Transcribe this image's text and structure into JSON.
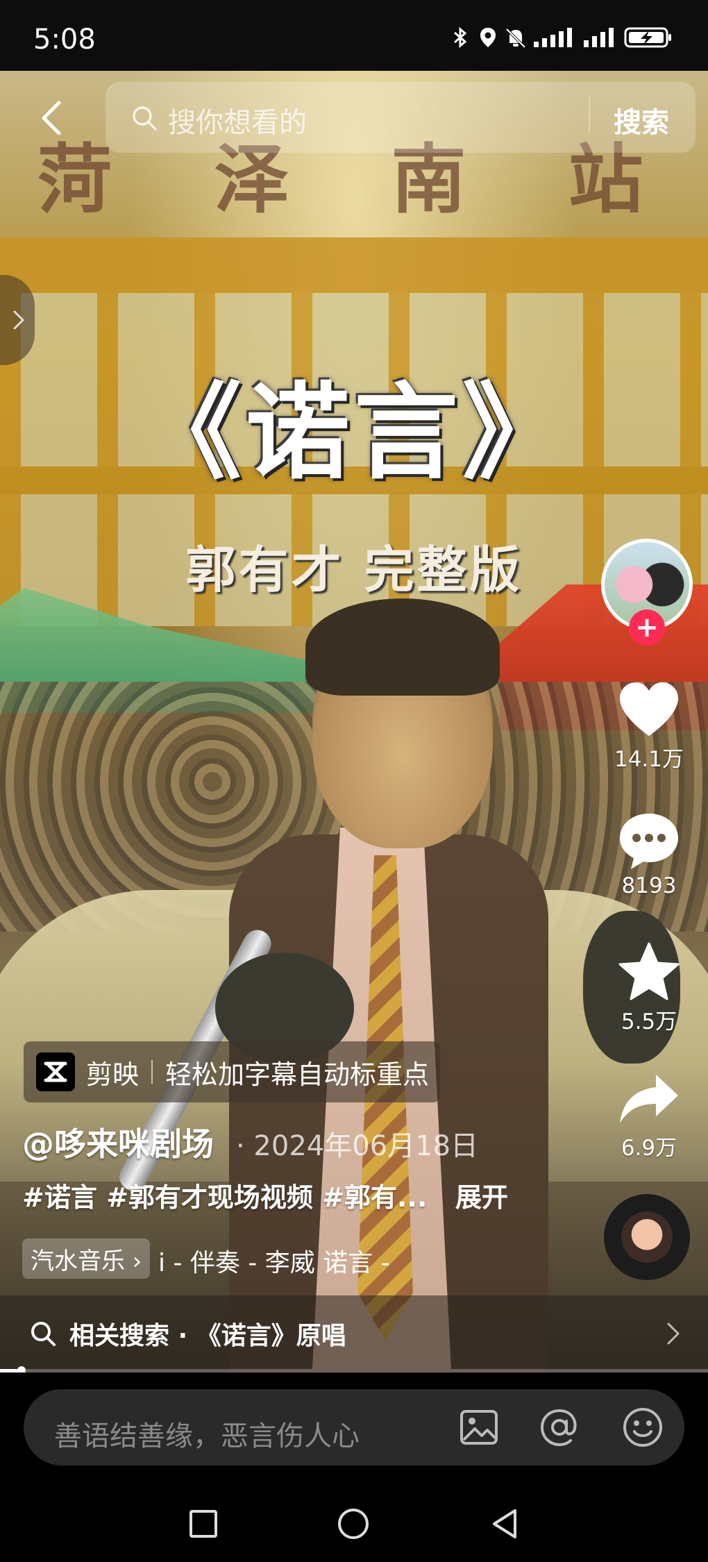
{
  "status_bar": {
    "time": "5:08",
    "icons": [
      "bluetooth-icon",
      "location-icon",
      "mute-icon",
      "signal-icon",
      "signal-icon",
      "battery-charging-icon"
    ]
  },
  "search": {
    "placeholder": "搜你想看的",
    "button_label": "搜索"
  },
  "video": {
    "station_sign": [
      "菏",
      "泽",
      "南",
      "站"
    ],
    "title_overlay": "《诺言》",
    "subtitle_overlay": "郭有才  完整版"
  },
  "actions": {
    "follow_label": "+",
    "like_count": "14.1万",
    "comment_count": "8193",
    "favorite_count": "5.5万",
    "share_count": "6.9万"
  },
  "info": {
    "capcut_name": "剪映",
    "capcut_text": "轻松加字幕自动标重点",
    "author": "@哆来咪剧场",
    "date": "· 2024年06月18日",
    "hashtags": "#诺言 #郭有才现场视频 #郭有...",
    "expand": "展开",
    "music_chip": "汽水音乐 ›",
    "music_track": "i - 伴奏 - 李威    诺言 -"
  },
  "related": {
    "text": "相关搜索 · 《诺言》原唱"
  },
  "progress": {
    "fraction": 0.03
  },
  "comment": {
    "placeholder": "善语结善缘，恶言伤人心"
  },
  "colors": {
    "accent": "#fe2c55",
    "background": "#000000"
  }
}
